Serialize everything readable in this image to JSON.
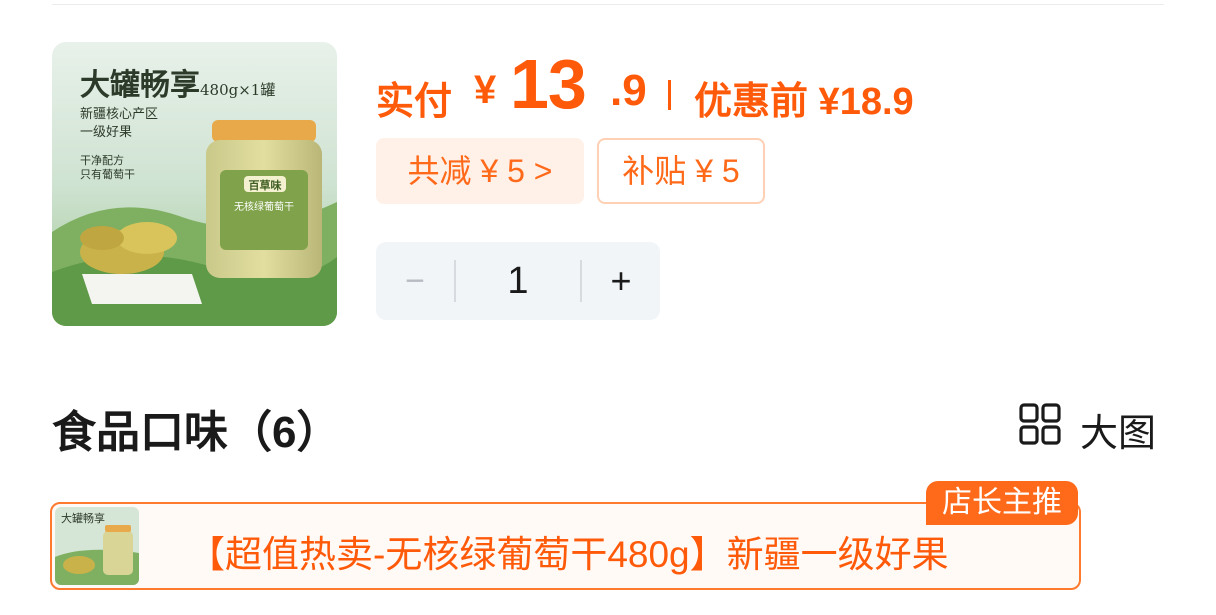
{
  "product": {
    "image_overlay": {
      "headline": "大罐畅享",
      "spec": "480g×1罐",
      "origin_line1": "新疆核心产区",
      "origin_line2": "一级好果",
      "process_line1": "干净配方",
      "process_line2": "只有葡萄干",
      "jar_brand": "百草味",
      "jar_product": "无核绿葡萄干"
    }
  },
  "price": {
    "actual_label": "实付",
    "currency": "¥",
    "actual_integer": "13",
    "actual_decimal": ".9",
    "before_label": "优惠前 ¥18.9"
  },
  "discounts": {
    "total_label": "共减 ¥ 5 >",
    "subsidy_label": "补贴 ¥ 5"
  },
  "stepper": {
    "minus": "−",
    "quantity": "1",
    "plus": "+"
  },
  "section": {
    "title": "食品口味（6）",
    "view_label": "大图"
  },
  "variants": [
    {
      "name": "【超值热卖-无核绿葡萄干480g】新疆一级好果",
      "badge": "店长主推",
      "thumb_caption": "大罐畅享"
    }
  ],
  "colors": {
    "accent": "#ff5a0a",
    "chip_bg": "#fff0e8",
    "stepper_bg": "#f2f5f8",
    "variant_border": "#ff7a2e"
  }
}
